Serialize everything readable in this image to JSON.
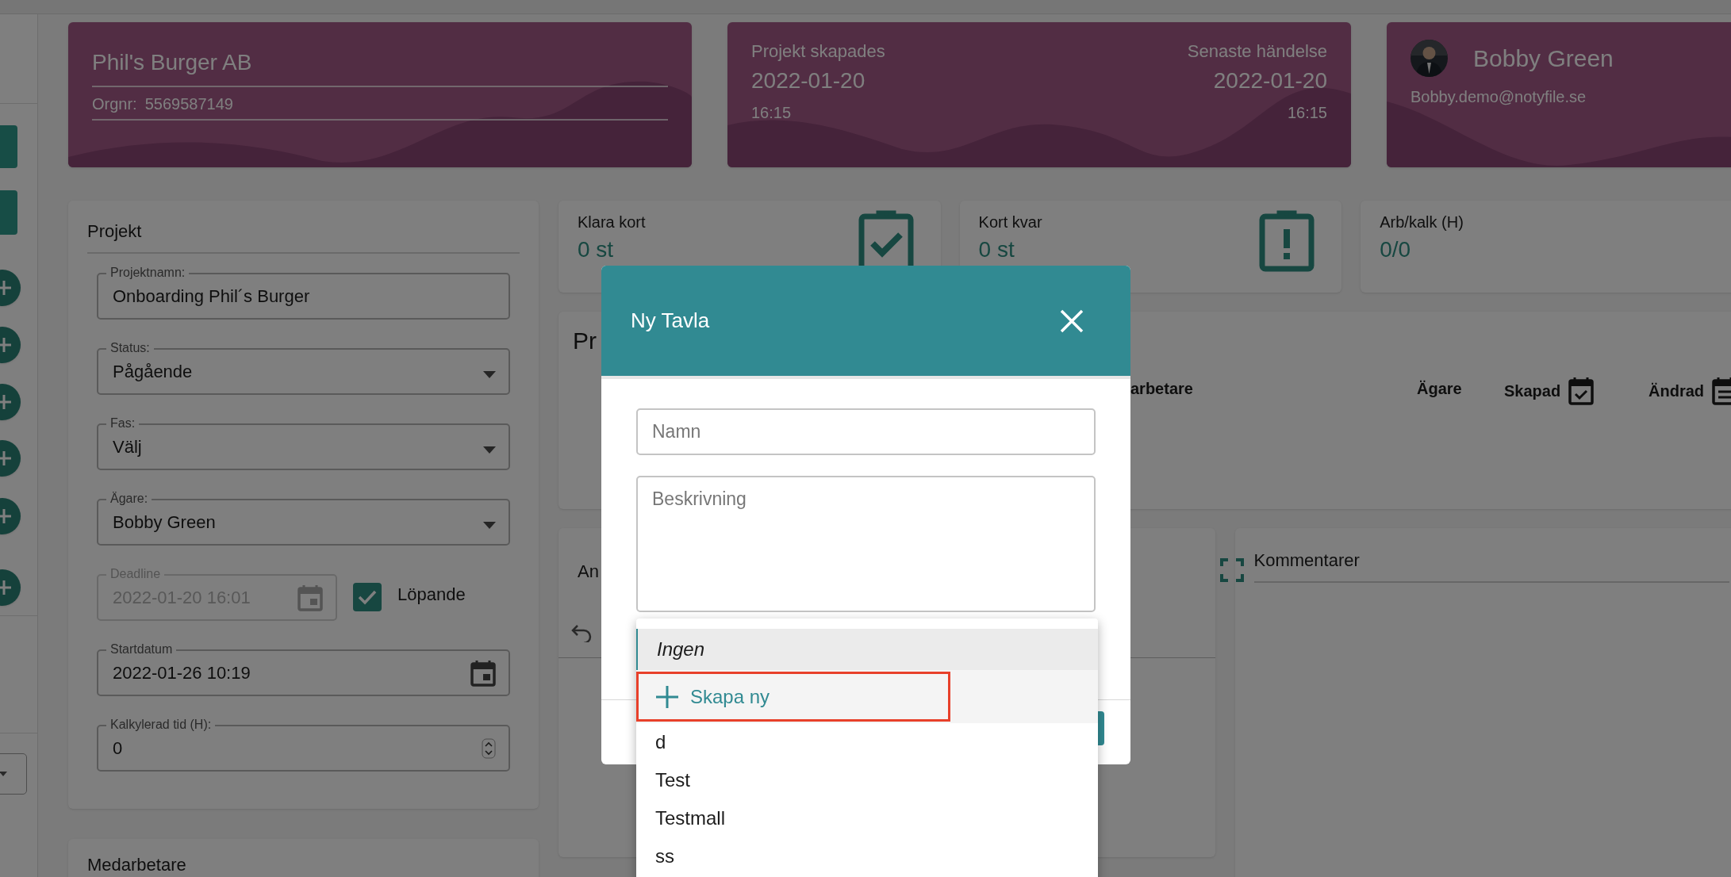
{
  "header_cards": {
    "company": {
      "name": "Phil's Burger AB",
      "orgnr_label": "Orgnr:",
      "orgnr": "5569587149"
    },
    "dates": {
      "created_label": "Projekt skapades",
      "created_date": "2022-01-20",
      "created_time": "16:15",
      "latest_label": "Senaste händelse",
      "latest_date": "2022-01-20",
      "latest_time": "16:15"
    },
    "user": {
      "name": "Bobby Green",
      "email": "Bobby.demo@notyfile.se"
    }
  },
  "project_form": {
    "title": "Projekt",
    "fields": [
      {
        "kind": "text",
        "label": "Projektnamn:",
        "value": "Onboarding Phil´s Burger",
        "disabled": false
      },
      {
        "kind": "select",
        "label": "Status:",
        "value": "Pågående",
        "disabled": false
      },
      {
        "kind": "select",
        "label": "Fas:",
        "value": "Välj",
        "disabled": false
      },
      {
        "kind": "select",
        "label": "Ägare:",
        "value": "Bobby Green",
        "disabled": false
      },
      {
        "kind": "date",
        "label": "Deadline",
        "value": "2022-01-20 16:01",
        "disabled": true,
        "checkbox": {
          "label": "Löpande",
          "checked": true
        }
      },
      {
        "kind": "date",
        "label": "Startdatum",
        "value": "2022-01-26 10:19",
        "disabled": false
      },
      {
        "kind": "number",
        "label": "Kalkylerad tid (H):",
        "value": "0",
        "disabled": false
      }
    ]
  },
  "staff_panel": {
    "title": "Medarbetare"
  },
  "stats": [
    {
      "kind": "done",
      "label": "Klara kort",
      "value": "0 st"
    },
    {
      "kind": "remaining",
      "label": "Kort kvar",
      "value": "0 st"
    },
    {
      "kind": "plain",
      "label": "Arb/kalk (H)",
      "value": "0/0"
    }
  ],
  "projects_panel": {
    "title": "Pr",
    "columns": [
      {
        "kind": "text",
        "label": "arbetare"
      },
      {
        "kind": "text",
        "label": "Ägare"
      },
      {
        "kind": "created",
        "label": "Skapad"
      },
      {
        "kind": "changed",
        "label": "Ändrad"
      }
    ]
  },
  "boards_panel": {
    "title": "An"
  },
  "comments_panel": {
    "title": "Kommentarer"
  },
  "modal": {
    "title": "Ny Tavla",
    "name_placeholder": "Namn",
    "description_placeholder": "Beskrivning",
    "options": [
      {
        "kind": "none",
        "label": "Ingen",
        "selected": true,
        "highlighted": false
      },
      {
        "kind": "create",
        "label": "Skapa ny",
        "selected": false,
        "highlighted": true
      },
      {
        "kind": "template",
        "label": "d",
        "selected": false,
        "highlighted": false
      },
      {
        "kind": "template",
        "label": "Test",
        "selected": false,
        "highlighted": false
      },
      {
        "kind": "template",
        "label": "Testmall",
        "selected": false,
        "highlighted": false
      },
      {
        "kind": "template",
        "label": "ss",
        "selected": false,
        "highlighted": false
      }
    ]
  }
}
